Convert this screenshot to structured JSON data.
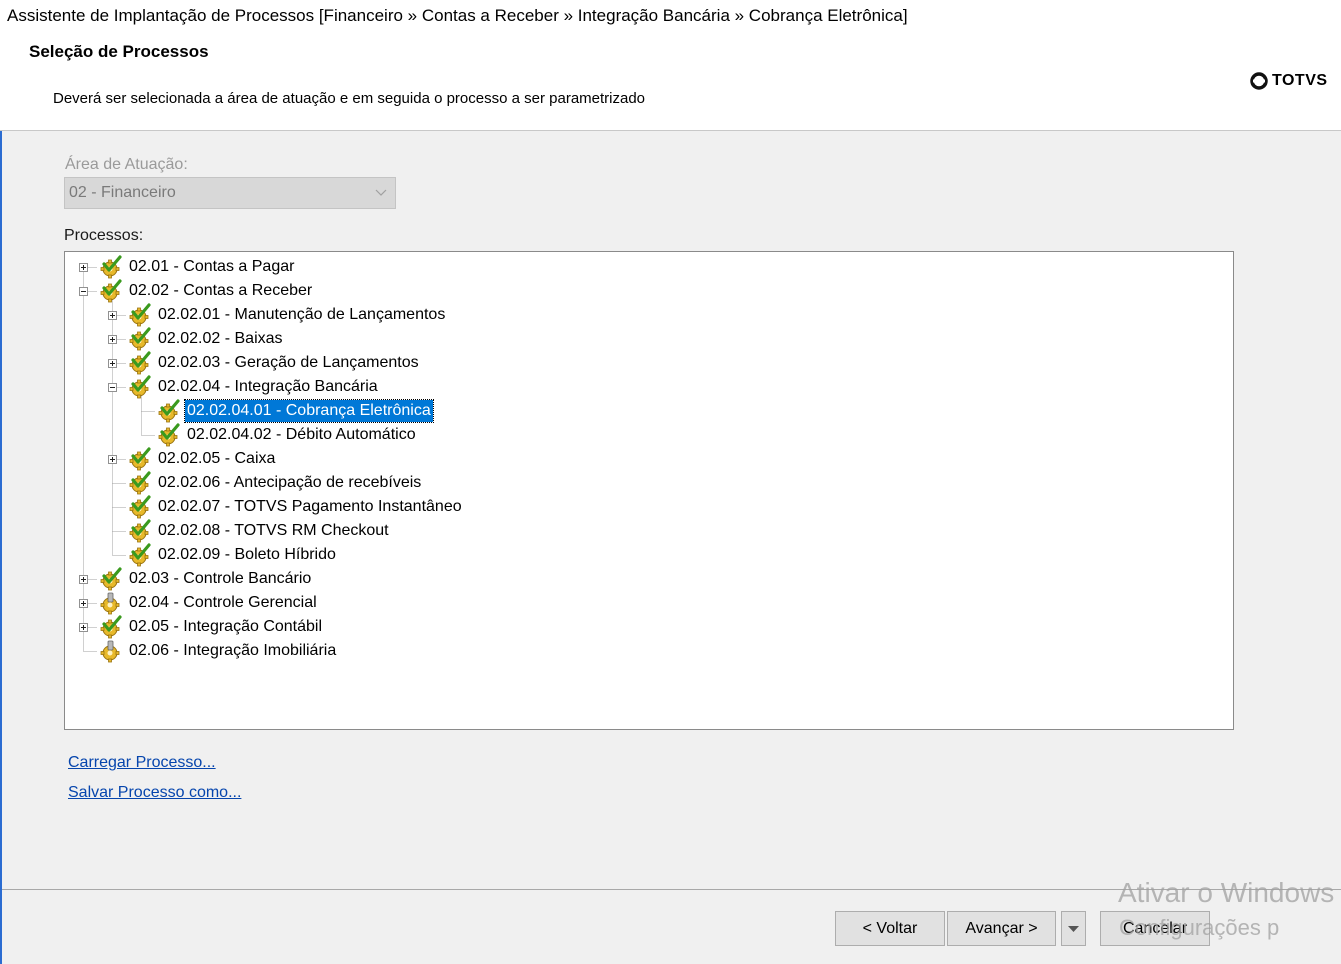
{
  "window": {
    "title": "Assistente de Implantação de Processos [Financeiro » Contas a Receber » Integração Bancária » Cobrança Eletrônica]"
  },
  "header": {
    "title": "Seleção de Processos",
    "description": "Deverá ser selecionada a área de atuação e em seguida o processo a ser parametrizado",
    "logo_text": "TOTVS"
  },
  "area": {
    "label": "Área de Atuação:",
    "selected": "02 - Financeiro"
  },
  "processes": {
    "label": "Processos:",
    "nodes": [
      {
        "label": "02.01 - Contas a Pagar",
        "level": 0,
        "expander": "plus",
        "icon": "gear-check-icon"
      },
      {
        "label": "02.02 - Contas a Receber",
        "level": 0,
        "expander": "minus",
        "icon": "gear-check-icon"
      },
      {
        "label": "02.02.01 - Manutenção de Lançamentos",
        "level": 1,
        "expander": "plus",
        "icon": "gear-check-icon"
      },
      {
        "label": "02.02.02 - Baixas",
        "level": 1,
        "expander": "plus",
        "icon": "gear-check-icon"
      },
      {
        "label": "02.02.03 - Geração de Lançamentos",
        "level": 1,
        "expander": "plus",
        "icon": "gear-check-icon"
      },
      {
        "label": "02.02.04 - Integração Bancária",
        "level": 1,
        "expander": "minus",
        "icon": "gear-check-icon"
      },
      {
        "label": "02.02.04.01 - Cobrança Eletrônica",
        "level": 2,
        "expander": "none",
        "icon": "gear-check-icon",
        "selected": true
      },
      {
        "label": "02.02.04.02 - Débito Automático",
        "level": 2,
        "expander": "none",
        "icon": "gear-check-icon"
      },
      {
        "label": "02.02.05 - Caixa",
        "level": 1,
        "expander": "plus",
        "icon": "gear-check-icon"
      },
      {
        "label": "02.02.06 - Antecipação de recebíveis",
        "level": 1,
        "expander": "none",
        "icon": "gear-check-icon"
      },
      {
        "label": "02.02.07 - TOTVS Pagamento Instantâneo",
        "level": 1,
        "expander": "none",
        "icon": "gear-check-icon"
      },
      {
        "label": "02.02.08 - TOTVS RM Checkout",
        "level": 1,
        "expander": "none",
        "icon": "gear-check-icon"
      },
      {
        "label": "02.02.09 - Boleto Híbrido",
        "level": 1,
        "expander": "none",
        "icon": "gear-check-icon"
      },
      {
        "label": "02.03 - Controle Bancário",
        "level": 0,
        "expander": "plus",
        "icon": "gear-check-icon"
      },
      {
        "label": "02.04 - Controle Gerencial",
        "level": 0,
        "expander": "plus",
        "icon": "gear-icon"
      },
      {
        "label": "02.05 - Integração Contábil",
        "level": 0,
        "expander": "plus",
        "icon": "gear-check-icon"
      },
      {
        "label": "02.06 - Integração Imobiliária",
        "level": 0,
        "expander": "none",
        "icon": "gear-icon"
      }
    ]
  },
  "links": {
    "load": "Carregar Processo...",
    "save": "Salvar Processo como..."
  },
  "buttons": {
    "back": "< Voltar",
    "next": "Avançar >",
    "cancel": "Cancelar"
  },
  "watermark": {
    "line1": "Ativar o Windows",
    "line2": "Configurações p"
  },
  "colors": {
    "selection": "#0078d7",
    "link": "#0645ad",
    "gear": "#e8b92a",
    "check": "#3a9a1e"
  }
}
